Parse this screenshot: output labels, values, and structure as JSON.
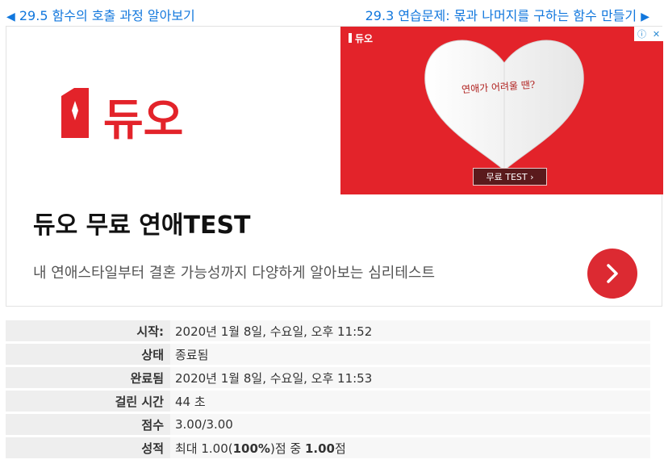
{
  "nav": {
    "prev": {
      "arrow": "◀",
      "label": "29.5 함수의 호출 과정 알아보기"
    },
    "next": {
      "label": "29.3 연습문제: 몫과 나머지를 구하는 함수 만들기",
      "arrow": "▶"
    }
  },
  "ad": {
    "logo_text": "듀오",
    "banner": {
      "logo_text": "듀오",
      "heart_text": "연애가 어려울 땐?",
      "button_label": "무료 TEST ›",
      "adchoices_icon": "info-icon",
      "close_icon": "close-icon"
    },
    "title": "듀오 무료 연애TEST",
    "description": "내 연애스타일부터 결혼 가능성까지 다양하게 알아보는 심리테스트",
    "cta_icon": "chevron-right-icon",
    "colors": {
      "brand_red": "#e3232a",
      "cta_red": "#dc2a32"
    }
  },
  "summary": [
    {
      "label": "시작:",
      "value": "2020년 1월 8일, 수요일, 오후 11:52"
    },
    {
      "label": "상태",
      "value": "종료됨"
    },
    {
      "label": "완료됨",
      "value": "2020년 1월 8일, 수요일, 오후 11:53"
    },
    {
      "label": "걸린 시간",
      "value": "44 초"
    },
    {
      "label": "점수",
      "value": "3.00/3.00"
    },
    {
      "label": "성적",
      "value_prefix": "최대 1.00(",
      "value_percent": "100%",
      "value_middle": ")점 중 ",
      "value_score": "1.00",
      "value_suffix": "점"
    }
  ]
}
